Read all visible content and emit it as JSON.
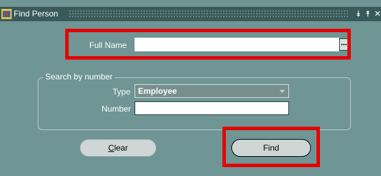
{
  "window": {
    "title": "Find Person",
    "controls": [
      "minimize-icon",
      "maximize-icon",
      "close-icon"
    ],
    "control_glyphs": [
      "⯯",
      "⯭",
      "✕"
    ]
  },
  "form": {
    "full_name": {
      "label": "Full Name",
      "value": ""
    },
    "search_by_number": {
      "legend": "Search by number",
      "type": {
        "label": "Type",
        "selected": "Employee"
      },
      "number": {
        "label": "Number",
        "value": ""
      }
    },
    "buttons": {
      "clear": {
        "mnemonic": "C",
        "rest": "lear"
      },
      "find": {
        "label": "Find"
      }
    }
  },
  "highlight_color": "#e60000",
  "colors": {
    "canvas": "#6f9595",
    "titlebar": "#3a5a5a"
  }
}
